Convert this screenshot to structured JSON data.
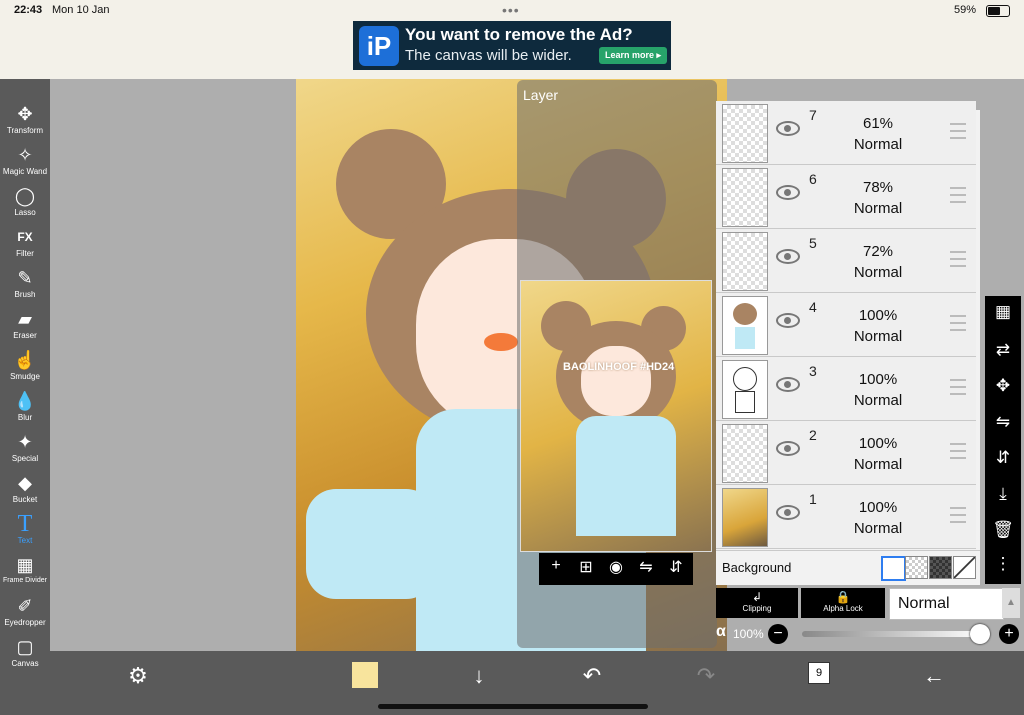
{
  "status": {
    "time": "22:43",
    "date": "Mon 10 Jan",
    "battery": "59%",
    "battery_level": 0.59
  },
  "ad": {
    "line1": "You want to remove the Ad?",
    "line2": "The canvas will be wider.",
    "button": "Learn more ▸",
    "logo_text": "iP"
  },
  "left_toolbar": [
    {
      "label": "Transform",
      "icon": "✥"
    },
    {
      "label": "Magic Wand",
      "icon": "✧"
    },
    {
      "label": "Lasso",
      "icon": "◯"
    },
    {
      "label": "Filter",
      "icon": "FX"
    },
    {
      "label": "Brush",
      "icon": "✎"
    },
    {
      "label": "Eraser",
      "icon": "▰"
    },
    {
      "label": "Smudge",
      "icon": "☝"
    },
    {
      "label": "Blur",
      "icon": "💧"
    },
    {
      "label": "Special",
      "icon": "✦"
    },
    {
      "label": "Bucket",
      "icon": "◆"
    },
    {
      "label": "Text",
      "icon": "T",
      "selected": true
    },
    {
      "label": "Frame Divider",
      "icon": "▦"
    },
    {
      "label": "Eyedropper",
      "icon": "✐"
    },
    {
      "label": "Canvas",
      "icon": "▢"
    }
  ],
  "layer_panel": {
    "title": "Layer",
    "layers": [
      {
        "number": "7",
        "opacity": "61%",
        "blend": "Normal"
      },
      {
        "number": "6",
        "opacity": "78%",
        "blend": "Normal"
      },
      {
        "number": "5",
        "opacity": "72%",
        "blend": "Normal"
      },
      {
        "number": "4",
        "opacity": "100%",
        "blend": "Normal"
      },
      {
        "number": "3",
        "opacity": "100%",
        "blend": "Normal"
      },
      {
        "number": "2",
        "opacity": "100%",
        "blend": "Normal"
      },
      {
        "number": "1",
        "opacity": "100%",
        "blend": "Normal"
      }
    ],
    "background_label": "Background",
    "clipping_label": "Clipping",
    "alpha_lock_label": "Alpha Lock",
    "blend_mode": "Normal",
    "alpha_symbol": "α",
    "alpha_value": "100%"
  },
  "preview_text": "BAOLINHOOF #HD24",
  "bottom_bar": {
    "layers_count": "9",
    "color_hex": "#f8e49d"
  },
  "icons": [
    "transform-icon",
    "magic-wand-icon",
    "lasso-icon",
    "filter-icon",
    "brush-icon",
    "eraser-icon",
    "smudge-icon",
    "blur-icon",
    "special-icon",
    "bucket-icon",
    "text-icon",
    "frame-divider-icon",
    "eyedropper-icon",
    "canvas-icon",
    "eye-icon",
    "drag-handle-icon",
    "checker-icon",
    "move-icon",
    "flip-icon",
    "merge-down-icon",
    "trash-icon",
    "more-icon",
    "undo-icon",
    "redo-icon",
    "back-arrow-icon",
    "download-icon"
  ]
}
